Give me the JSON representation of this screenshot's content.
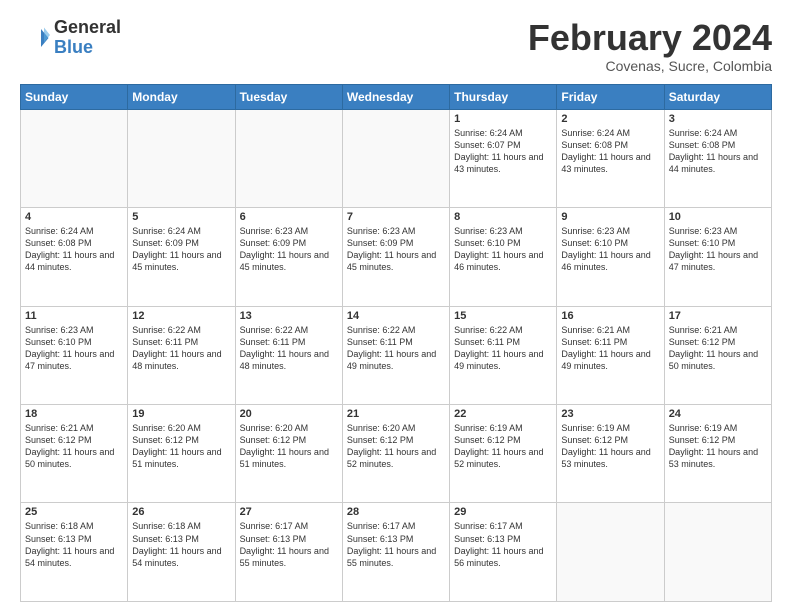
{
  "header": {
    "logo_general": "General",
    "logo_blue": "Blue",
    "month_title": "February 2024",
    "location": "Covenas, Sucre, Colombia"
  },
  "weekdays": [
    "Sunday",
    "Monday",
    "Tuesday",
    "Wednesday",
    "Thursday",
    "Friday",
    "Saturday"
  ],
  "weeks": [
    [
      {
        "day": "",
        "detail": ""
      },
      {
        "day": "",
        "detail": ""
      },
      {
        "day": "",
        "detail": ""
      },
      {
        "day": "",
        "detail": ""
      },
      {
        "day": "1",
        "detail": "Sunrise: 6:24 AM\nSunset: 6:07 PM\nDaylight: 11 hours\nand 43 minutes."
      },
      {
        "day": "2",
        "detail": "Sunrise: 6:24 AM\nSunset: 6:08 PM\nDaylight: 11 hours\nand 43 minutes."
      },
      {
        "day": "3",
        "detail": "Sunrise: 6:24 AM\nSunset: 6:08 PM\nDaylight: 11 hours\nand 44 minutes."
      }
    ],
    [
      {
        "day": "4",
        "detail": "Sunrise: 6:24 AM\nSunset: 6:08 PM\nDaylight: 11 hours\nand 44 minutes."
      },
      {
        "day": "5",
        "detail": "Sunrise: 6:24 AM\nSunset: 6:09 PM\nDaylight: 11 hours\nand 45 minutes."
      },
      {
        "day": "6",
        "detail": "Sunrise: 6:23 AM\nSunset: 6:09 PM\nDaylight: 11 hours\nand 45 minutes."
      },
      {
        "day": "7",
        "detail": "Sunrise: 6:23 AM\nSunset: 6:09 PM\nDaylight: 11 hours\nand 45 minutes."
      },
      {
        "day": "8",
        "detail": "Sunrise: 6:23 AM\nSunset: 6:10 PM\nDaylight: 11 hours\nand 46 minutes."
      },
      {
        "day": "9",
        "detail": "Sunrise: 6:23 AM\nSunset: 6:10 PM\nDaylight: 11 hours\nand 46 minutes."
      },
      {
        "day": "10",
        "detail": "Sunrise: 6:23 AM\nSunset: 6:10 PM\nDaylight: 11 hours\nand 47 minutes."
      }
    ],
    [
      {
        "day": "11",
        "detail": "Sunrise: 6:23 AM\nSunset: 6:10 PM\nDaylight: 11 hours\nand 47 minutes."
      },
      {
        "day": "12",
        "detail": "Sunrise: 6:22 AM\nSunset: 6:11 PM\nDaylight: 11 hours\nand 48 minutes."
      },
      {
        "day": "13",
        "detail": "Sunrise: 6:22 AM\nSunset: 6:11 PM\nDaylight: 11 hours\nand 48 minutes."
      },
      {
        "day": "14",
        "detail": "Sunrise: 6:22 AM\nSunset: 6:11 PM\nDaylight: 11 hours\nand 49 minutes."
      },
      {
        "day": "15",
        "detail": "Sunrise: 6:22 AM\nSunset: 6:11 PM\nDaylight: 11 hours\nand 49 minutes."
      },
      {
        "day": "16",
        "detail": "Sunrise: 6:21 AM\nSunset: 6:11 PM\nDaylight: 11 hours\nand 49 minutes."
      },
      {
        "day": "17",
        "detail": "Sunrise: 6:21 AM\nSunset: 6:12 PM\nDaylight: 11 hours\nand 50 minutes."
      }
    ],
    [
      {
        "day": "18",
        "detail": "Sunrise: 6:21 AM\nSunset: 6:12 PM\nDaylight: 11 hours\nand 50 minutes."
      },
      {
        "day": "19",
        "detail": "Sunrise: 6:20 AM\nSunset: 6:12 PM\nDaylight: 11 hours\nand 51 minutes."
      },
      {
        "day": "20",
        "detail": "Sunrise: 6:20 AM\nSunset: 6:12 PM\nDaylight: 11 hours\nand 51 minutes."
      },
      {
        "day": "21",
        "detail": "Sunrise: 6:20 AM\nSunset: 6:12 PM\nDaylight: 11 hours\nand 52 minutes."
      },
      {
        "day": "22",
        "detail": "Sunrise: 6:19 AM\nSunset: 6:12 PM\nDaylight: 11 hours\nand 52 minutes."
      },
      {
        "day": "23",
        "detail": "Sunrise: 6:19 AM\nSunset: 6:12 PM\nDaylight: 11 hours\nand 53 minutes."
      },
      {
        "day": "24",
        "detail": "Sunrise: 6:19 AM\nSunset: 6:12 PM\nDaylight: 11 hours\nand 53 minutes."
      }
    ],
    [
      {
        "day": "25",
        "detail": "Sunrise: 6:18 AM\nSunset: 6:13 PM\nDaylight: 11 hours\nand 54 minutes."
      },
      {
        "day": "26",
        "detail": "Sunrise: 6:18 AM\nSunset: 6:13 PM\nDaylight: 11 hours\nand 54 minutes."
      },
      {
        "day": "27",
        "detail": "Sunrise: 6:17 AM\nSunset: 6:13 PM\nDaylight: 11 hours\nand 55 minutes."
      },
      {
        "day": "28",
        "detail": "Sunrise: 6:17 AM\nSunset: 6:13 PM\nDaylight: 11 hours\nand 55 minutes."
      },
      {
        "day": "29",
        "detail": "Sunrise: 6:17 AM\nSunset: 6:13 PM\nDaylight: 11 hours\nand 56 minutes."
      },
      {
        "day": "",
        "detail": ""
      },
      {
        "day": "",
        "detail": ""
      }
    ]
  ]
}
